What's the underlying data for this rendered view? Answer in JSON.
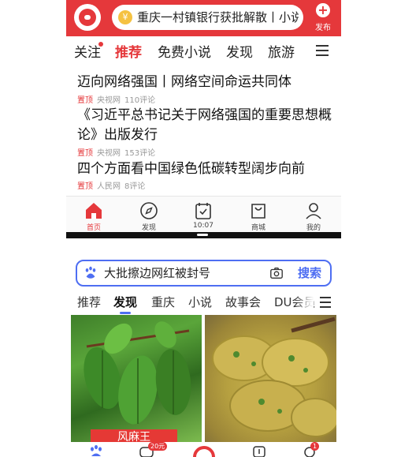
{
  "top_app": {
    "search_placeholder": "重庆一村镇银行获批解散丨小说",
    "search_coin": "¥",
    "publish_label": "发布",
    "publish_plus": "+",
    "tabs": [
      {
        "label": "关注"
      },
      {
        "label": "推荐"
      },
      {
        "label": "免费小说"
      },
      {
        "label": "发现"
      },
      {
        "label": "旅游"
      }
    ],
    "news": [
      {
        "title": "迈向网络强国丨网络空间命运共同体",
        "tag": "置顶",
        "source": "央视网",
        "comments": "110评论"
      },
      {
        "title": "《习近平总书记关于网络强国的重要思想概论》出版发行",
        "tag": "置顶",
        "source": "央视网",
        "comments": "153评论"
      },
      {
        "title": "四个方面看中国绿色低碳转型阔步向前",
        "tag": "置顶",
        "source": "人民网",
        "comments": "8评论"
      }
    ],
    "bottom_nav": [
      {
        "label": "首页",
        "icon": "home-icon"
      },
      {
        "label": "发现",
        "icon": "compass-icon"
      },
      {
        "label": "10:07",
        "icon": "checkbox-icon"
      },
      {
        "label": "商城",
        "icon": "shopping-bag-icon"
      },
      {
        "label": "我的",
        "icon": "user-icon"
      }
    ]
  },
  "bottom_app": {
    "search_text": "大批擦边网红被封号",
    "search_button": "搜索",
    "tabs": [
      {
        "label": "推荐"
      },
      {
        "label": "发现"
      },
      {
        "label": "重庆"
      },
      {
        "label": "小说"
      },
      {
        "label": "故事会"
      },
      {
        "label": "DU会员"
      }
    ],
    "image_left_caption": "风麻王",
    "nav_badge_1": "20元",
    "nav_badge_2": "1"
  },
  "colors": {
    "toutiao_red": "#e5383b",
    "baidu_blue": "#4e6ef2"
  }
}
